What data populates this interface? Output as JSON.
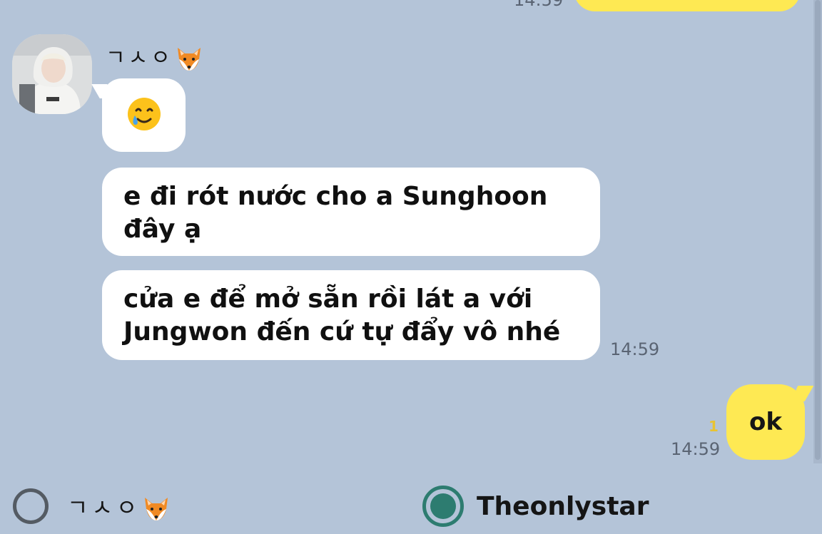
{
  "conversation": {
    "previous_time": "14:59",
    "sender": {
      "name": "ㄱㅅㅇ",
      "name_emoji": "fox-face-icon"
    },
    "incoming": [
      {
        "type": "emoji",
        "icon": "smiling-face-with-tear-icon"
      },
      {
        "type": "text",
        "text": "e đi rót nước cho a Sunghoon đây ạ"
      },
      {
        "type": "text",
        "text": "cửa e để mở sẵn rồi lát a với Jungwon đến cứ tự đẩy vô nhé"
      }
    ],
    "incoming_time": "14:59",
    "outgoing": {
      "text": "ok",
      "time": "14:59",
      "unread_count": "1"
    }
  },
  "footer": {
    "options": [
      {
        "label": "ㄱㅅㅇ",
        "emoji": "fox-face-icon",
        "selected": false
      },
      {
        "label": "Theonlystar",
        "selected": true
      }
    ]
  },
  "colors": {
    "background": "#b4c4d8",
    "incoming_bubble": "#ffffff",
    "outgoing_bubble": "#fee953",
    "selected_radio": "#2d7c70"
  }
}
